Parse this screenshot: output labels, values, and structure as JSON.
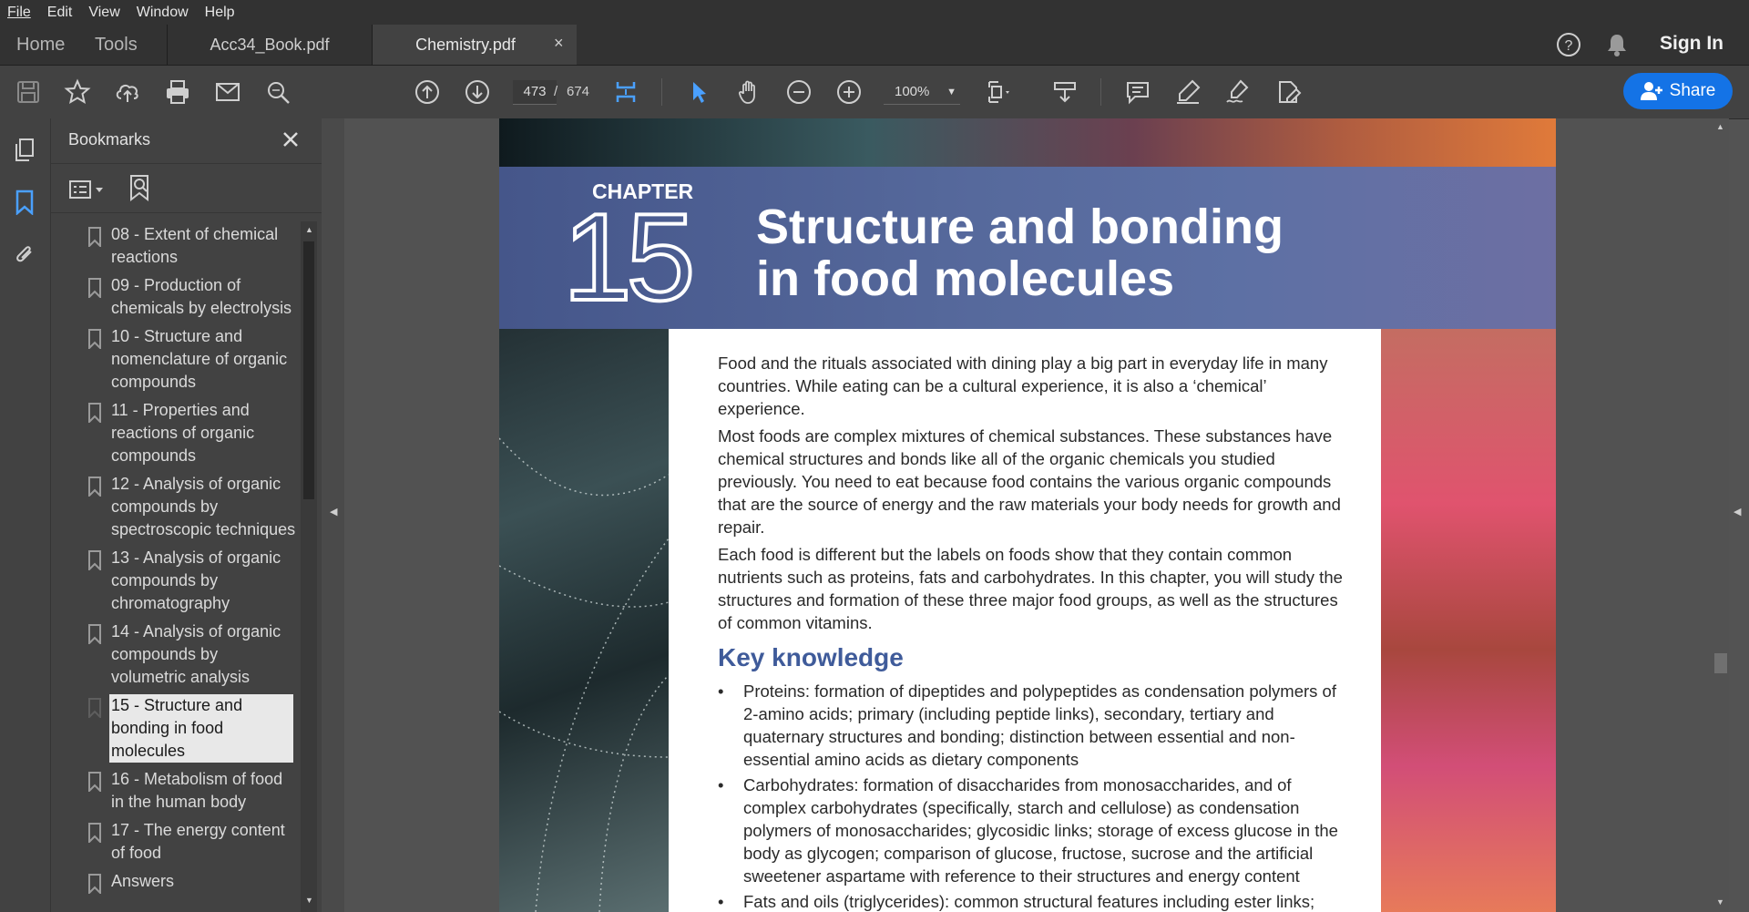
{
  "menu": {
    "items": [
      "File",
      "Edit",
      "View",
      "Window",
      "Help"
    ]
  },
  "tabs": {
    "home": "Home",
    "tools": "Tools",
    "documents": [
      {
        "label": "Acc34_Book.pdf",
        "active": false
      },
      {
        "label": "Chemistry.pdf",
        "active": true,
        "close": "×"
      }
    ],
    "sign_in": "Sign In"
  },
  "toolbar": {
    "page_current": "473",
    "page_separator": "/",
    "page_total": "674",
    "zoom": "100%",
    "share_label": "Share"
  },
  "bookmarks": {
    "title": "Bookmarks",
    "items": [
      {
        "label": "08 - Extent of chemical reactions"
      },
      {
        "label": "09 - Production of chemicals by electrolysis"
      },
      {
        "label": "10 - Structure and nomenclature of organic compounds"
      },
      {
        "label": "11 - Properties and reactions of organic compounds"
      },
      {
        "label": "12 - Analysis of organic compounds by spectroscopic techniques"
      },
      {
        "label": "13 - Analysis of organic compounds by chromatography"
      },
      {
        "label": "14 - Analysis of organic compounds by volumetric analysis"
      },
      {
        "label": "15 - Structure and bonding in food molecules",
        "selected": true
      },
      {
        "label": "16 - Metabolism of food in the human body"
      },
      {
        "label": "17 - The energy content of food"
      },
      {
        "label": "Answers"
      }
    ]
  },
  "document": {
    "chapter_word": "CHAPTER",
    "chapter_number": "15",
    "title_line1": "Structure and bonding",
    "title_line2": "in food molecules",
    "paragraphs": [
      "Food and the rituals associated with dining play a big part in everyday life in many countries. While eating can be a cultural experience, it is also a ‘chemical’ experience.",
      "Most foods are complex mixtures of chemical substances. These substances have chemical structures and bonds like all of the organic chemicals you studied previously. You need to eat because food contains the various organic compounds that are the source of energy and the raw materials your body needs for growth and repair.",
      "Each food is different but the labels on foods show that they contain common nutrients such as proteins, fats and carbohydrates. In this chapter, you will study the structures and formation of these three major food groups, as well as the structures of common vitamins."
    ],
    "key_heading": "Key knowledge",
    "bullets": [
      "Proteins: formation of dipeptides and polypeptides as condensation polymers of 2-amino acids; primary (including peptide links), secondary, tertiary and quaternary structures and bonding; distinction between essential and non-essential amino acids as dietary components",
      "Carbohydrates: formation of disaccharides from monosaccharides, and of complex carbohydrates (specifically, starch and cellulose) as condensation polymers of monosaccharides; glycosidic links; storage of excess glucose in the body as glycogen; comparison of glucose, fructose, sucrose and the artificial sweetener aspartame with reference to their structures and energy content",
      "Fats and oils (triglycerides): common structural features including ester links;"
    ]
  },
  "colors": {
    "accent_blue": "#3f5b9a",
    "share_button": "#1473e6",
    "selected_bookmark_bg": "#e8e8e8"
  }
}
